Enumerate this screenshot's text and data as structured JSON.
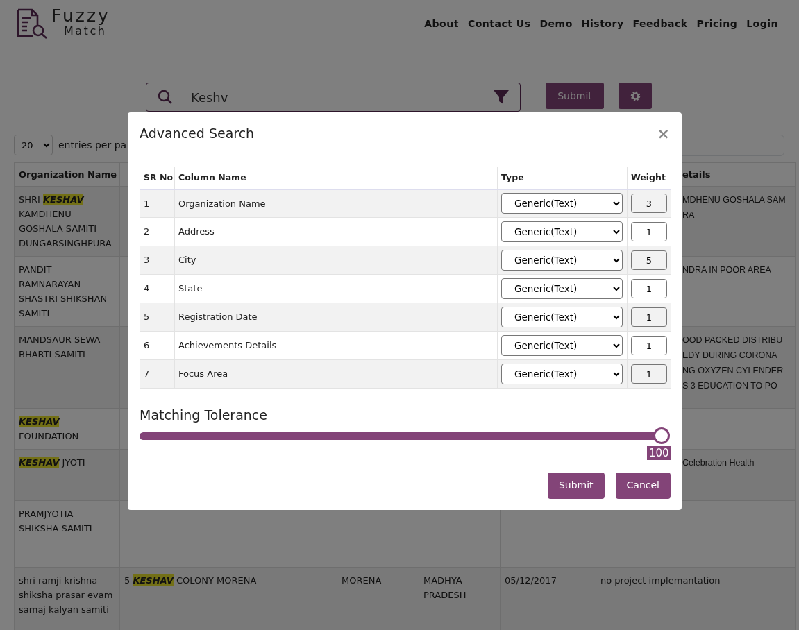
{
  "header": {
    "logo_top": "Fuzzy",
    "logo_bottom": "Match",
    "nav": [
      "About",
      "Contact Us",
      "Demo",
      "History",
      "Feedback",
      "Pricing",
      "Login"
    ]
  },
  "search": {
    "value": "Keshv",
    "submit": "Submit"
  },
  "entries": {
    "value": "20",
    "label": "entries per pa"
  },
  "results": {
    "header": {
      "column_1": "Organization Name",
      "column_6": "etails"
    },
    "rows": [
      {
        "column_1": "SHRI **KESHAV** KAMDHENU GOSHALA SAMITI DUNGARSINGHPURA",
        "column_6": [
          "MDHENU GOSHALA SAM",
          "RA"
        ]
      },
      {
        "column_1": "PANDIT RAMNARAYAN SHASTRI SHIKSHAN SAMITI",
        "column_6": [
          "NDRA IN POOR AREA"
        ]
      },
      {
        "column_1": "MANDSAUR SEWA BHARTI SAMITI",
        "column_6": [
          "OOD PACKED DISTRIBU",
          "EDY DURING CORONA",
          "NG OXYZEN CYLENDER",
          "S 3 EDUCATION TO PO"
        ]
      },
      {
        "column_1": "**KESHAV** FOUNDATION"
      },
      {
        "column_1": "**KESHAV** JYOTI",
        "column_6": [
          "Celebration Health"
        ]
      },
      {
        "column_1": "PRAMJYOTIA SHIKSHA SAMITI"
      },
      {
        "column_1": "shri ramji krishna shiksha prasar evam samaj kalyan samiti",
        "column_2": "5 **KESHAV** COLONY MORENA",
        "column_3": "MORENA",
        "column_4": "MADHYA PRADESH",
        "column_5": "05/12/2017",
        "column_6": [
          "no project implemantation"
        ]
      }
    ]
  },
  "modal": {
    "title": "Advanced Search",
    "close": "×",
    "columns": [
      "SR No",
      "Column Name",
      "Type",
      "Weight"
    ],
    "rows": [
      {
        "sr": "1",
        "name": "Organization Name",
        "type": "Generic(Text)",
        "weight": "3"
      },
      {
        "sr": "2",
        "name": "Address",
        "type": "Generic(Text)",
        "weight": "1"
      },
      {
        "sr": "3",
        "name": "City",
        "type": "Generic(Text)",
        "weight": "5"
      },
      {
        "sr": "4",
        "name": "State",
        "type": "Generic(Text)",
        "weight": "1"
      },
      {
        "sr": "5",
        "name": "Registration Date",
        "type": "Generic(Text)",
        "weight": "1"
      },
      {
        "sr": "6",
        "name": "Achievements Details",
        "type": "Generic(Text)",
        "weight": "1"
      },
      {
        "sr": "7",
        "name": "Focus Area",
        "type": "Generic(Text)",
        "weight": "1"
      }
    ],
    "tolerance": {
      "label": "Matching Tolerance",
      "level": 1,
      "reading": "100"
    },
    "buttons": [
      "Submit",
      "Cancel"
    ]
  }
}
